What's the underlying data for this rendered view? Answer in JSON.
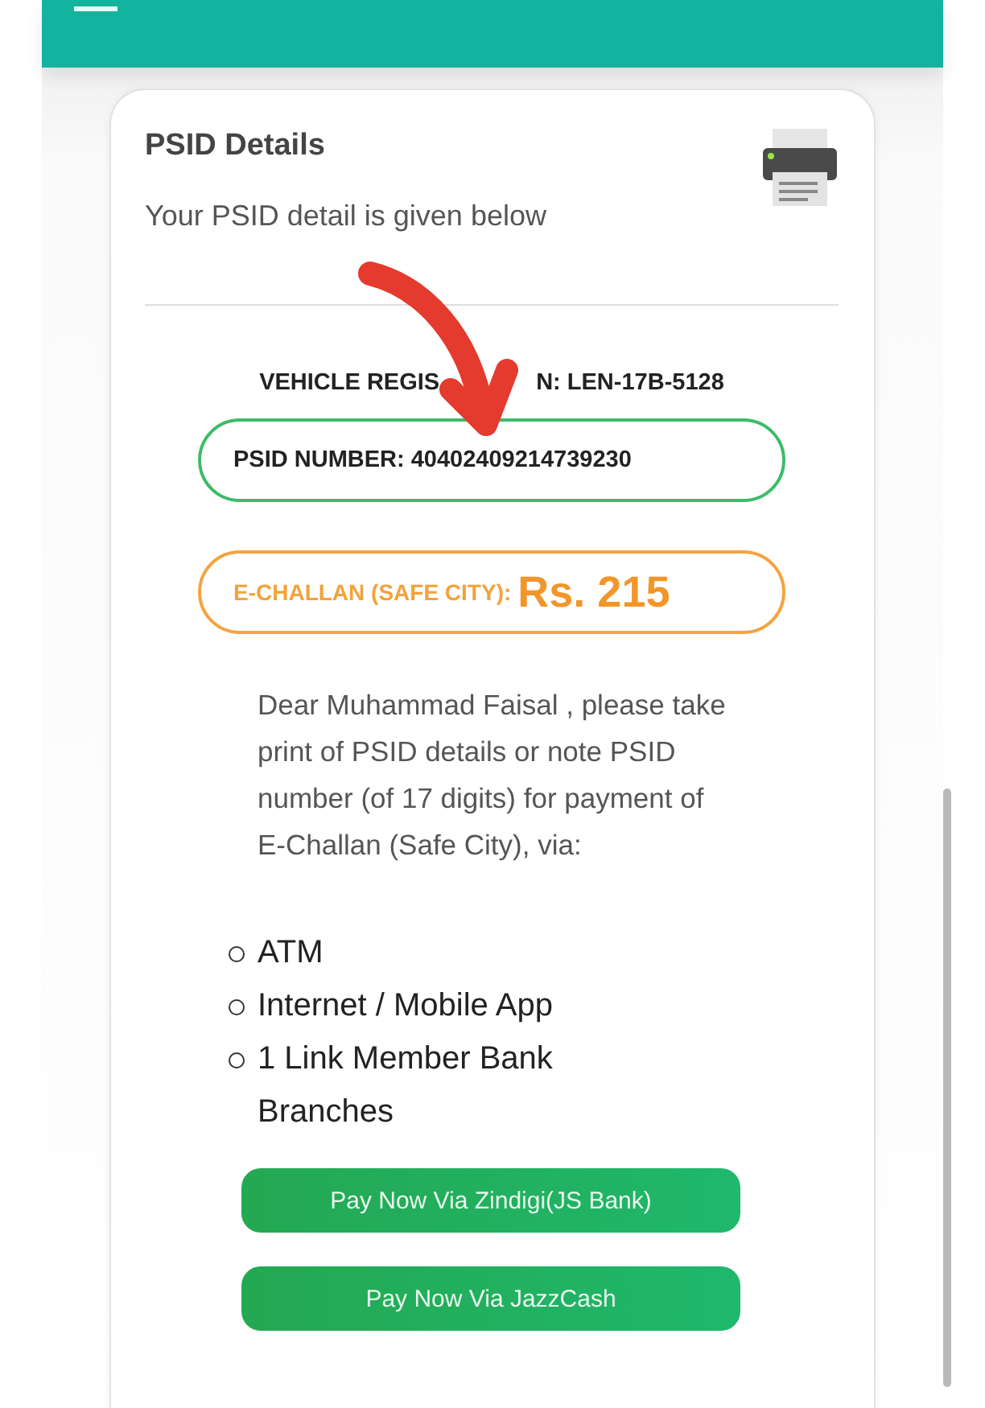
{
  "app_bar": {
    "kind": "cut_off"
  },
  "card": {
    "title": "PSID Details",
    "subtitle": "Your PSID detail is given below",
    "vehicle_registration_parts": [
      "VEHICLE REGIS",
      "N: LEN-17B-5128"
    ],
    "psid": {
      "label": "PSID NUMBER:",
      "value": "40402409214739230"
    },
    "challan": {
      "label": "E-CHALLAN (SAFE CITY):",
      "amount": "Rs. 215"
    },
    "message": "Dear Muhammad Faisal , please take print of PSID details or note PSID number (of 17 digits) for payment of E-Challan (Safe City), via:",
    "channels": [
      "ATM",
      "Internet / Mobile App",
      "1 Link Member Bank Branches"
    ],
    "buttons": [
      "Pay Now Via Zindigi(JS Bank)",
      "Pay Now Via JazzCash"
    ]
  },
  "annotation": {
    "kind": "arrow"
  }
}
